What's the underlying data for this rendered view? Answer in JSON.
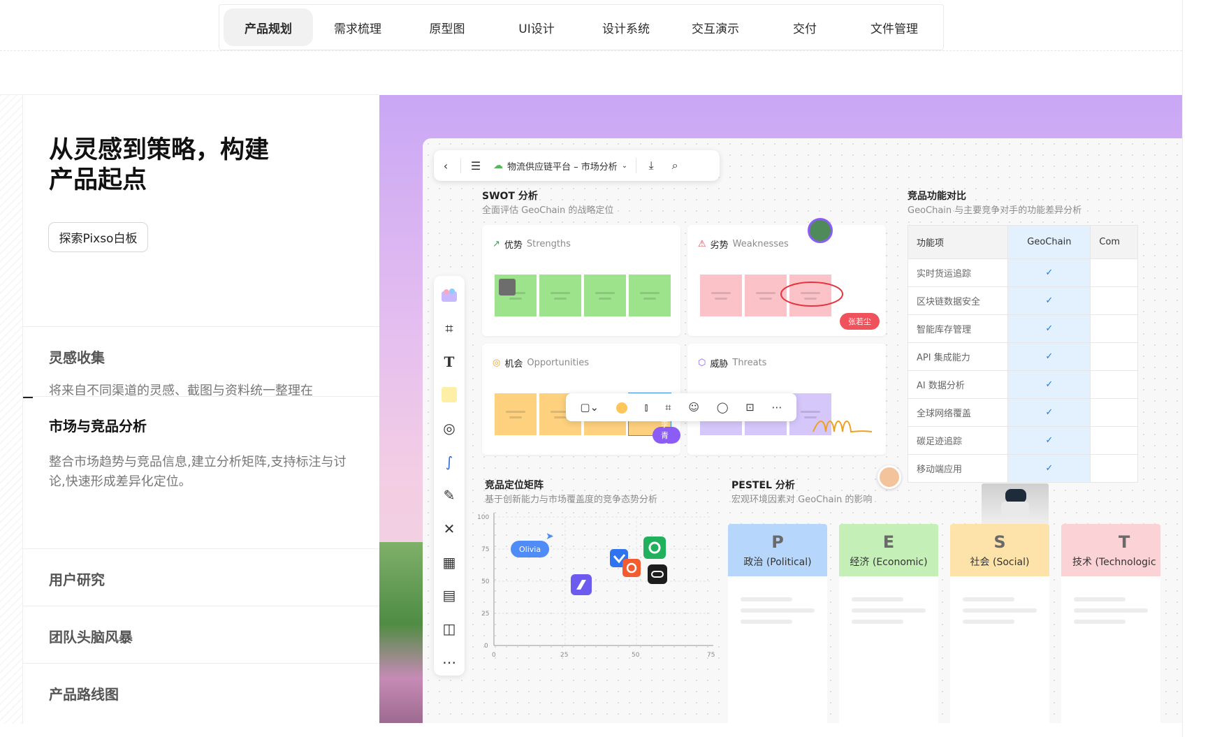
{
  "tabs": [
    {
      "label": "产品规划",
      "active": true
    },
    {
      "label": "需求梳理"
    },
    {
      "label": "原型图"
    },
    {
      "label": "UI设计"
    },
    {
      "label": "设计系统"
    },
    {
      "label": "交互演示"
    },
    {
      "label": "交付"
    },
    {
      "label": "文件管理"
    }
  ],
  "hero": {
    "title_line1": "从灵感到策略，构建",
    "title_line2": "产品起点",
    "cta": "探索Pixso白板"
  },
  "accordion": [
    {
      "title": "灵感收集",
      "desc": "将来自不同渠道的灵感、截图与资料统一整理在"
    },
    {
      "title": "市场与竞品分析",
      "desc": "整合市场趋势与竞品信息,建立分析矩阵,支持标注与讨论,快速形成差异化定位。",
      "active": true
    },
    {
      "title": "用户研究"
    },
    {
      "title": "团队头脑风暴"
    },
    {
      "title": "产品路线图"
    }
  ],
  "canvas": {
    "toolbar": {
      "doc_title": "物流供应链平台 – 市场分析"
    },
    "swot": {
      "title": "SWOT 分析",
      "subtitle": "全面评估 GeoChain 的战略定位",
      "strengths": {
        "zh": "优势",
        "en": "Strengths"
      },
      "weaknesses": {
        "zh": "劣势",
        "en": "Weaknesses"
      },
      "opportunities": {
        "zh": "机会",
        "en": "Opportunities"
      },
      "threats": {
        "zh": "威胁",
        "en": "Threats"
      }
    },
    "collaborators": {
      "user1": "张若尘",
      "user2": "李青禾",
      "user3": "Olivia"
    },
    "compare": {
      "title": "竞品功能对比",
      "subtitle": "GeoChain 与主要竞争对手的功能差异分析",
      "col_feature": "功能项",
      "col_geochain": "GeoChain",
      "col_other": "Com",
      "rows": [
        "实时货运追踪",
        "区块链数据安全",
        "智能库存管理",
        "API 集成能力",
        "AI 数据分析",
        "全球网络覆盖",
        "碳足迹追踪",
        "移动端应用"
      ],
      "check": "✓"
    },
    "matrix": {
      "title": "竞品定位矩阵",
      "subtitle": "基于创新能力与市场覆盖度的竞争态势分析",
      "y_ticks": [
        "100",
        "75",
        "50",
        "25",
        "0"
      ],
      "x_ticks": [
        "0",
        "25",
        "50",
        "75"
      ]
    },
    "pestel": {
      "title": "PESTEL 分析",
      "subtitle": "宏观环境因素对 GeoChain 的影响",
      "items": [
        {
          "letter": "P",
          "label": "政治 (Political)",
          "color": "#b7d6fb"
        },
        {
          "letter": "E",
          "label": "经济 (Economic)",
          "color": "#c4efb6"
        },
        {
          "letter": "S",
          "label": "社会 (Social)",
          "color": "#fde2a9"
        },
        {
          "letter": "T",
          "label": "技术 (Technologic",
          "color": "#fbd3d6"
        }
      ]
    }
  },
  "colors": {
    "accent_red": "#f0525c",
    "accent_purple": "#8b5cf6",
    "accent_blue": "#4f8cf7",
    "geochain_col": "#e3f0fd"
  }
}
